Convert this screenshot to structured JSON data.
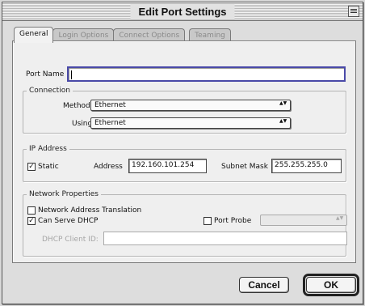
{
  "window": {
    "title": "Edit Port Settings"
  },
  "tabs": [
    {
      "label": "General",
      "active": true
    },
    {
      "label": "Login Options",
      "active": false
    },
    {
      "label": "Connect Options",
      "active": false
    },
    {
      "label": "Teaming",
      "active": false
    }
  ],
  "port_name": {
    "label": "Port Name",
    "value": ""
  },
  "connection": {
    "legend": "Connection",
    "method_label": "Method",
    "method_value": "Ethernet",
    "using_label": "Using",
    "using_value": "Ethernet"
  },
  "ip_address": {
    "legend": "IP Address",
    "static_label": "Static",
    "static_checked": true,
    "address_label": "Address",
    "address_value": "192.160.101.254",
    "subnet_label": "Subnet Mask",
    "subnet_value": "255.255.255.0"
  },
  "network_properties": {
    "legend": "Network Properties",
    "nat_label": "Network Address Translation",
    "nat_checked": false,
    "dhcp_label": "Can Serve DHCP",
    "dhcp_checked": true,
    "port_probe_label": "Port Probe",
    "port_probe_checked": false,
    "port_probe_value": "",
    "dhcp_client_id_label": "DHCP Client ID:",
    "dhcp_client_id_value": ""
  },
  "buttons": {
    "cancel": "Cancel",
    "ok": "OK"
  },
  "glyphs": {
    "check": "✓",
    "popup_arrows": "▲▼"
  }
}
